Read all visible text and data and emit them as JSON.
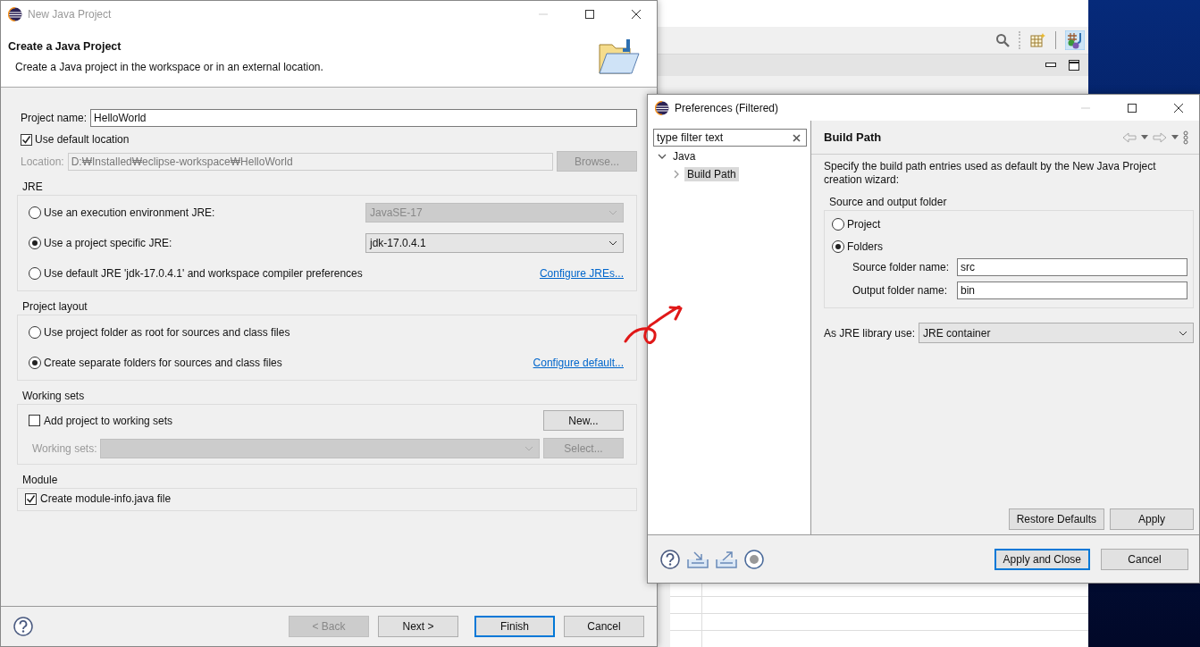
{
  "wizard": {
    "title": "New Java Project",
    "heading": "Create a Java Project",
    "description": "Create a Java project in the workspace or in an external location.",
    "project_name": {
      "label": "Project name:",
      "value": "HelloWorld"
    },
    "use_default_location": {
      "label": "Use default location",
      "checked": true
    },
    "location": {
      "label": "Location:",
      "value": "D:₩Installed₩eclipse-workspace₩HelloWorld",
      "disabled": true
    },
    "browse_button": {
      "label": "Browse...",
      "disabled": true
    },
    "jre": {
      "title": "JRE",
      "options": [
        {
          "label": "Use an execution environment JRE:",
          "selected": false,
          "dropdown": {
            "value": "JavaSE-17",
            "disabled": true
          }
        },
        {
          "label": "Use a project specific JRE:",
          "selected": true,
          "dropdown": {
            "value": "jdk-17.0.4.1",
            "disabled": false
          }
        },
        {
          "label": "Use default JRE 'jdk-17.0.4.1' and workspace compiler preferences",
          "selected": false,
          "link": "Configure JREs..."
        }
      ]
    },
    "project_layout": {
      "title": "Project layout",
      "options": [
        {
          "label": "Use project folder as root for sources and class files",
          "selected": false
        },
        {
          "label": "Create separate folders for sources and class files",
          "selected": true
        }
      ],
      "link": "Configure default..."
    },
    "working_sets": {
      "title": "Working sets",
      "add": {
        "label": "Add project to working sets",
        "checked": false
      },
      "new_button": {
        "label": "New...",
        "disabled": false
      },
      "sets_label": "Working sets:",
      "sets_disabled": true,
      "select_button": {
        "label": "Select...",
        "disabled": true
      }
    },
    "module": {
      "title": "Module",
      "create": {
        "label": "Create module-info.java file",
        "checked": true
      }
    },
    "buttons": [
      {
        "label": "< Back",
        "disabled": true,
        "default": false
      },
      {
        "label": "Next >",
        "disabled": false,
        "default": false
      },
      {
        "label": "Finish",
        "disabled": false,
        "default": true
      },
      {
        "label": "Cancel",
        "disabled": false,
        "default": false
      }
    ]
  },
  "preferences": {
    "title": "Preferences (Filtered)",
    "filter": {
      "value": "type filter text"
    },
    "tree": [
      {
        "label": "Java",
        "expanded": true,
        "selected": false,
        "children": [
          {
            "label": "Build Path",
            "expanded": false,
            "selected": true
          }
        ]
      }
    ],
    "page": {
      "title": "Build Path",
      "description": "Specify the build path entries used as default by the New Java Project creation wizard:",
      "group": {
        "title": "Source and output folder",
        "options": [
          {
            "label": "Project",
            "selected": false
          },
          {
            "label": "Folders",
            "selected": true
          }
        ],
        "fields": [
          {
            "label": "Source folder name:",
            "value": "src"
          },
          {
            "label": "Output folder name:",
            "value": "bin"
          }
        ]
      },
      "jre_library": {
        "label": "As JRE library use:",
        "value": "JRE container"
      },
      "buttons": [
        {
          "label": "Restore Defaults"
        },
        {
          "label": "Apply"
        }
      ]
    },
    "buttons": [
      {
        "label": "Apply and Close",
        "default": true
      },
      {
        "label": "Cancel",
        "default": false
      }
    ]
  }
}
